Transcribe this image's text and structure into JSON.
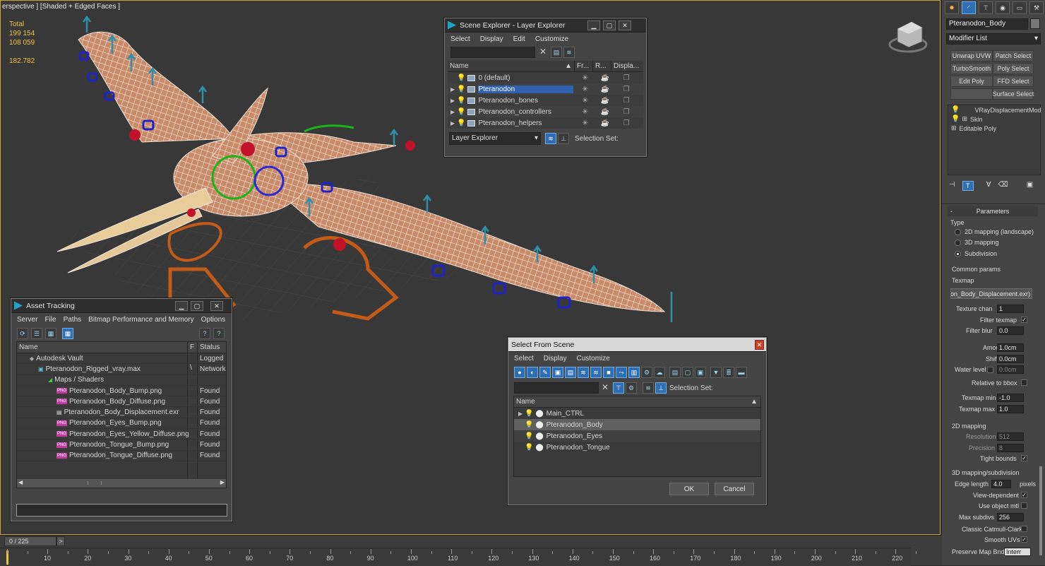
{
  "viewport": {
    "label": "erspective ] [Shaded + Edged Faces ]",
    "stats": {
      "total_label": "Total",
      "polys": "199 154",
      "verts": "108 059",
      "fps": "182.782"
    }
  },
  "scene_explorer": {
    "title": "Scene Explorer - Layer Explorer",
    "menu": [
      "Select",
      "Display",
      "Edit",
      "Customize"
    ],
    "columns": [
      "Name",
      "Fr...",
      "R...",
      "Displa..."
    ],
    "rows": [
      "0 (default)",
      "Pteranodon",
      "Pteranodon_bones",
      "Pteranodon_controllers",
      "Pteranodon_helpers"
    ],
    "footer_dropdown": "Layer Explorer",
    "selection_set_label": "Selection Set:"
  },
  "asset_tracking": {
    "title": "Asset Tracking",
    "menu": [
      "Server",
      "File",
      "Paths",
      "Bitmap Performance and Memory",
      "Options"
    ],
    "columns": [
      "Name",
      "F",
      "Status"
    ],
    "rows": [
      {
        "name": "Autodesk Vault",
        "f": "",
        "status": "Logged"
      },
      {
        "name": "Pteranodon_Rigged_vray.max",
        "f": "\\",
        "status": "Network"
      },
      {
        "name": "Maps / Shaders",
        "f": "",
        "status": ""
      },
      {
        "name": "Pteranodon_Body_Bump.png",
        "f": "",
        "status": "Found"
      },
      {
        "name": "Pteranodon_Body_Diffuse.png",
        "f": "",
        "status": "Found"
      },
      {
        "name": "Pteranodon_Body_Displacement.exr",
        "f": "",
        "status": "Found"
      },
      {
        "name": "Pteranodon_Eyes_Bump.png",
        "f": "",
        "status": "Found"
      },
      {
        "name": "Pteranodon_Eyes_Yellow_Diffuse.png",
        "f": "",
        "status": "Found"
      },
      {
        "name": "Pteranodon_Tongue_Bump.png",
        "f": "",
        "status": "Found"
      },
      {
        "name": "Pteranodon_Tongue_Diffuse.png",
        "f": "",
        "status": "Found"
      }
    ],
    "png_badge": "PNG"
  },
  "select_from_scene": {
    "title": "Select From Scene",
    "menu": [
      "Select",
      "Display",
      "Customize"
    ],
    "selection_set_label": "Selection Set:",
    "column": "Name",
    "rows": [
      "Main_CTRL",
      "Pteranodon_Body",
      "Pteranodon_Eyes",
      "Pteranodon_Tongue"
    ],
    "ok": "OK",
    "cancel": "Cancel"
  },
  "command_panel": {
    "object_name": "Pteranodon_Body",
    "modifier_list": "Modifier List",
    "mod_buttons": [
      "Unwrap UVW",
      "Patch Select",
      "TurboSmooth",
      "Poly Select",
      "Edit Poly",
      "FFD Select",
      "Surface Select"
    ],
    "stack": [
      "VRayDisplacementMod",
      "Skin",
      "Editable Poly"
    ],
    "parameters_title": "Parameters",
    "type_label": "Type",
    "type_options": [
      "2D mapping (landscape)",
      "3D mapping",
      "Subdivision"
    ],
    "common_params": "Common params",
    "texmap_label": "Texmap",
    "texmap_value": "on_Body_Displacement.exr)",
    "texture_chan_label": "Texture chan",
    "texture_chan": "1",
    "filter_texmap": "Filter texmap",
    "filter_blur_label": "Filter blur",
    "filter_blur": "0.0",
    "amount_label": "Amount",
    "amount": "1.0cm",
    "shift_label": "Shift",
    "shift": "0.0cm",
    "water_level_label": "Water level",
    "water_level": "0.0cm",
    "relative_bbox": "Relative to bbox",
    "texmap_min_label": "Texmap min",
    "texmap_min": "-1.0",
    "texmap_max_label": "Texmap max",
    "texmap_max": "1.0",
    "mapping2d": "2D mapping",
    "resolution_label": "Resolution",
    "resolution": "512",
    "precision_label": "Precision",
    "precision": "8",
    "tight_bounds": "Tight bounds",
    "mapping3d": "3D mapping/subdivision",
    "edge_length_label": "Edge length",
    "edge_length": "4.0",
    "pixels": "pixels",
    "view_dependent": "View-dependent",
    "use_object_mtl": "Use object mtl",
    "max_subdivs_label": "Max subdivs",
    "max_subdivs": "256",
    "classic_catmull": "Classic Catmull-Clark",
    "smooth_uvs": "Smooth UVs",
    "preserve_map_label": "Preserve Map Bnd",
    "preserve_map": "Interr"
  },
  "timeline": {
    "frame": "0 / 225",
    "arrow": ">",
    "ticks": [
      "10",
      "20",
      "30",
      "40",
      "50",
      "60",
      "70",
      "80",
      "90",
      "100",
      "110",
      "120",
      "130",
      "140",
      "150",
      "160",
      "170",
      "180",
      "190",
      "200",
      "210",
      "220"
    ]
  }
}
